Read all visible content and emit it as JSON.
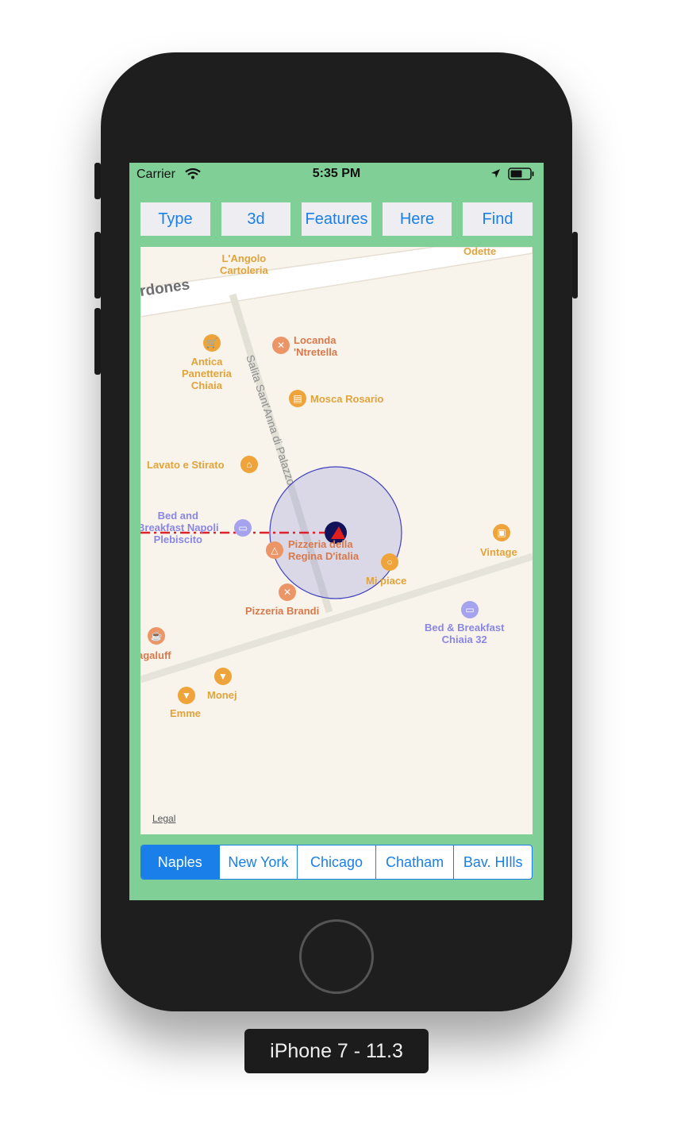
{
  "status_bar": {
    "carrier": "Carrier",
    "time": "5:35 PM"
  },
  "toolbar": {
    "buttons": [
      "Type",
      "3d",
      "Features",
      "Here",
      "Find"
    ]
  },
  "map": {
    "street_top": "rdones",
    "street_diag": "Salita Sant'Anna di Palazzo",
    "legal": "Legal",
    "pois": {
      "angolo": "L'Angolo\nCartoleria",
      "odette": "Odette",
      "locanda": "Locanda\n'Ntretella",
      "antica": "Antica\nPanetteria\nChiaia",
      "mosca": "Mosca Rosario",
      "lavato": "Lavato e Stirato",
      "bnb_napoli": "Bed and\nBreakfast Napoli\nPlebiscito",
      "pizzeria_italia": "Pizzeria della\nRegina D'italia",
      "vintage": "Vintage",
      "mi_piace": "Mi piace",
      "pizzeria_brandi": "Pizzeria Brandi",
      "bnb_chiaia": "Bed & Breakfast\nChiaia 32",
      "gaguff": "agaluff",
      "monej": "Monej",
      "emme": "Emme"
    }
  },
  "segments": {
    "items": [
      "Naples",
      "New York",
      "Chicago",
      "Chatham",
      "Bav. HIlls"
    ],
    "selected": "Naples"
  },
  "device_label": "iPhone 7 - 11.3",
  "colors": {
    "screen_bg": "#80cf96",
    "accent": "#1a7fe8",
    "route": "#e0202a",
    "circle": "#4040c0"
  }
}
